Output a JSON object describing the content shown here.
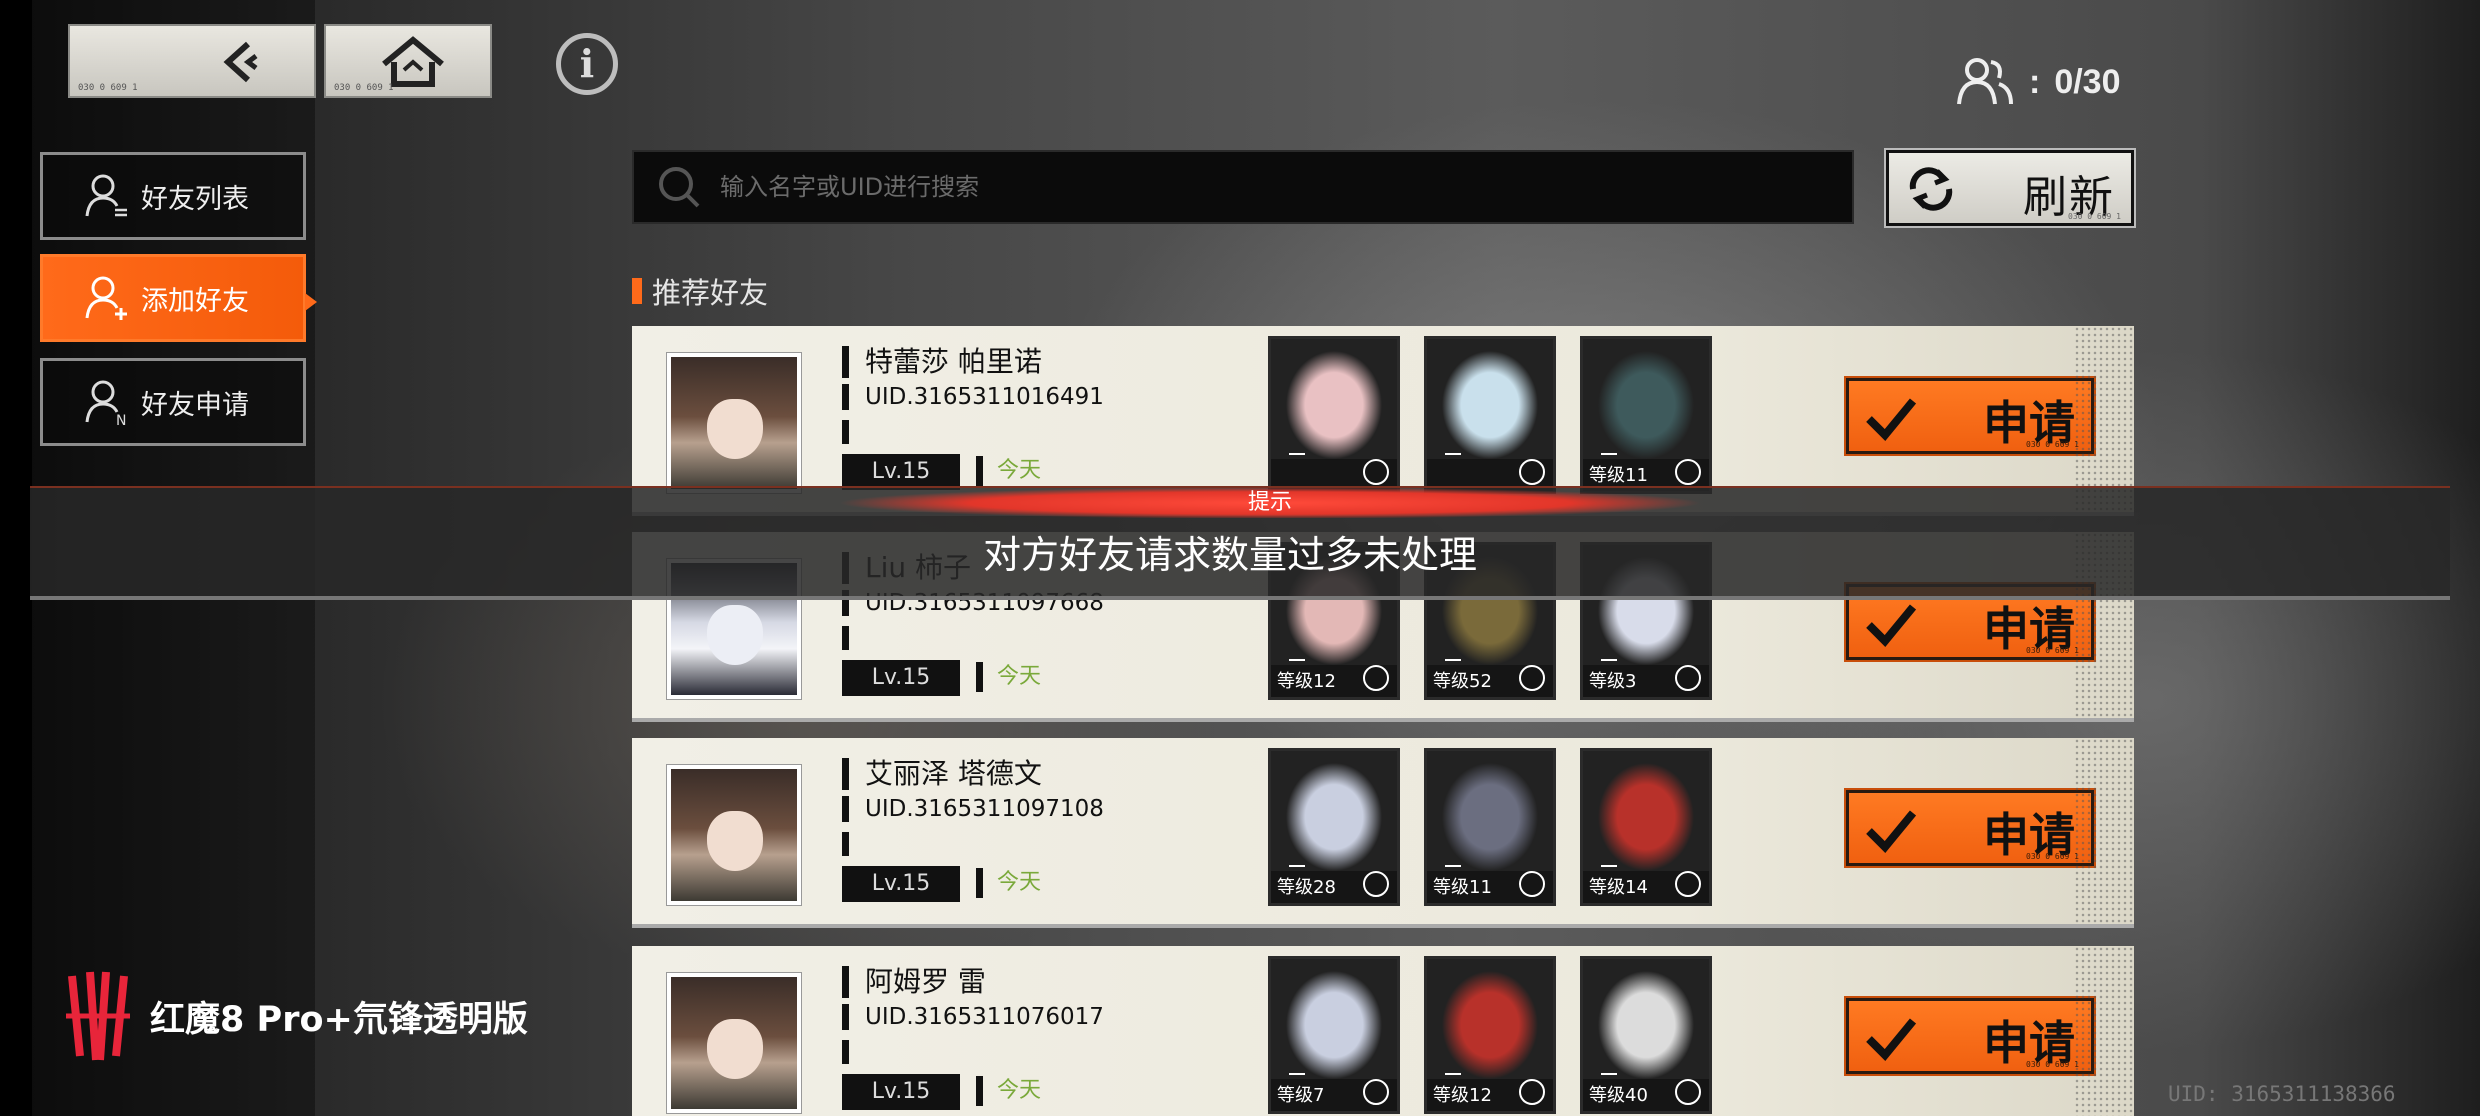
{
  "top": {
    "back_code": "030 0 609 1",
    "home_code": "030 0 609 1",
    "friend_count": "0/30",
    "friend_count_sep": ":"
  },
  "nav": {
    "items": [
      {
        "label": "好友列表",
        "active": false
      },
      {
        "label": "添加好友",
        "active": true
      },
      {
        "label": "好友申请",
        "active": false
      }
    ]
  },
  "search": {
    "placeholder": "输入名字或UID进行搜索",
    "refresh_label": "刷新",
    "refresh_code": "030 0 609 1"
  },
  "section_title": "推荐好友",
  "apply_label": "申请",
  "apply_code": "030 0 609 1",
  "friends": [
    {
      "name": "特蕾莎 帕里诺",
      "uid": "UID.3165311016491",
      "level": "Lv.15",
      "last_login": "今天",
      "characters": [
        {
          "level": ""
        },
        {
          "level": ""
        },
        {
          "level": "等级11"
        }
      ]
    },
    {
      "name": "Liu 柿子",
      "uid": "UID.3165311097668",
      "level": "Lv.15",
      "last_login": "今天",
      "characters": [
        {
          "level": "等级12"
        },
        {
          "level": "等级52"
        },
        {
          "level": "等级3"
        }
      ]
    },
    {
      "name": "艾丽泽 塔德文",
      "uid": "UID.3165311097108",
      "level": "Lv.15",
      "last_login": "今天",
      "characters": [
        {
          "level": "等级28"
        },
        {
          "level": "等级11"
        },
        {
          "level": "等级14"
        }
      ]
    },
    {
      "name": "阿姆罗 雷",
      "uid": "UID.3165311076017",
      "level": "Lv.15",
      "last_login": "今天",
      "characters": [
        {
          "level": "等级7"
        },
        {
          "level": "等级12"
        },
        {
          "level": "等级40"
        }
      ]
    }
  ],
  "toast": {
    "title": "提示",
    "message": "对方好友请求数量过多未处理"
  },
  "brand": "红魔8 Pro+氘锋透明版",
  "footer_uid": "UID: 3165311138366",
  "colors": {
    "accent": "#ff6a1a",
    "card_bg": "#f1efe6",
    "today_green": "#7aa93a",
    "toast_red": "#e2362a"
  }
}
